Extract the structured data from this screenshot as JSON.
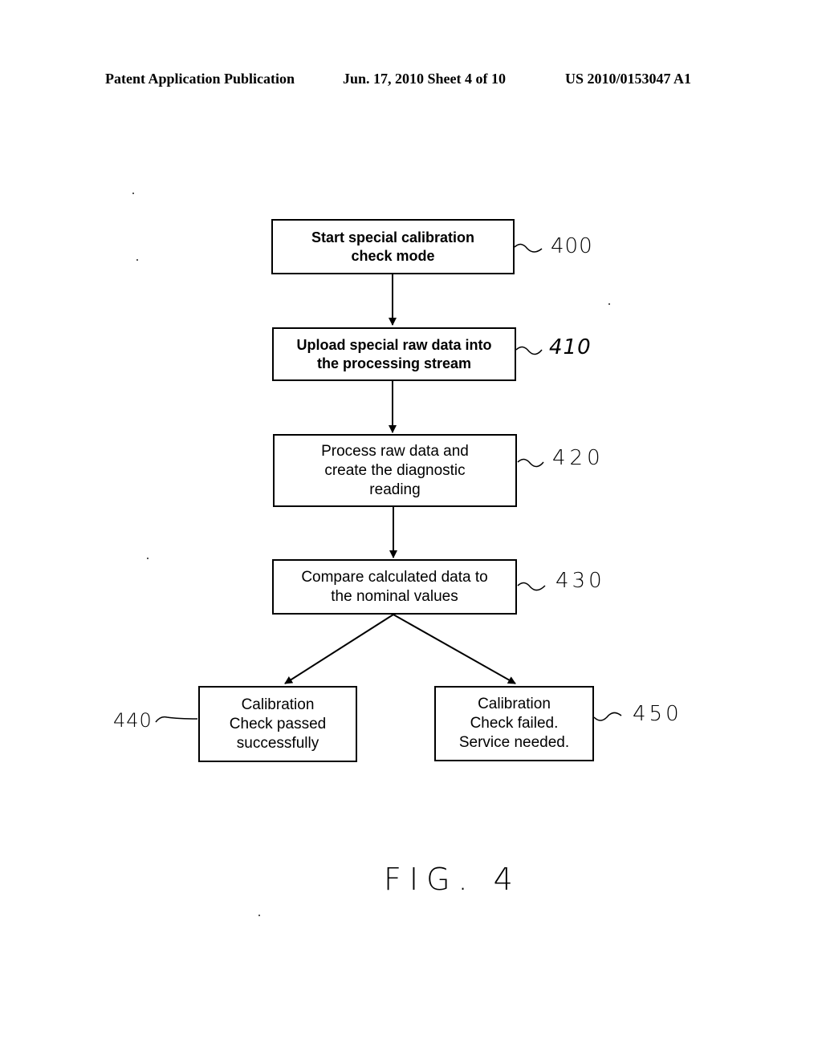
{
  "header": {
    "publication": "Patent Application Publication",
    "date_sheet": "Jun. 17, 2010  Sheet 4 of 10",
    "patent_number": "US 2010/0153047 A1"
  },
  "flowchart": {
    "steps": [
      {
        "id": "400",
        "text": "Start special calibration\ncheck mode",
        "ref": "400"
      },
      {
        "id": "410",
        "text": "Upload special raw data into\nthe processing stream",
        "ref": "410"
      },
      {
        "id": "420",
        "text": "Process raw data and\ncreate the diagnostic\nreading",
        "ref": "420"
      },
      {
        "id": "430",
        "text": "Compare calculated data to\nthe nominal values",
        "ref": "430"
      },
      {
        "id": "440",
        "text": "Calibration\nCheck passed\nsuccessfully",
        "ref": "440"
      },
      {
        "id": "450",
        "text": "Calibration\nCheck failed.\nService needed.",
        "ref": "450"
      }
    ],
    "edges": [
      {
        "from": "400",
        "to": "410"
      },
      {
        "from": "410",
        "to": "420"
      },
      {
        "from": "420",
        "to": "430"
      },
      {
        "from": "430",
        "to": "440"
      },
      {
        "from": "430",
        "to": "450"
      }
    ]
  },
  "figure_label": "FIG. 4"
}
